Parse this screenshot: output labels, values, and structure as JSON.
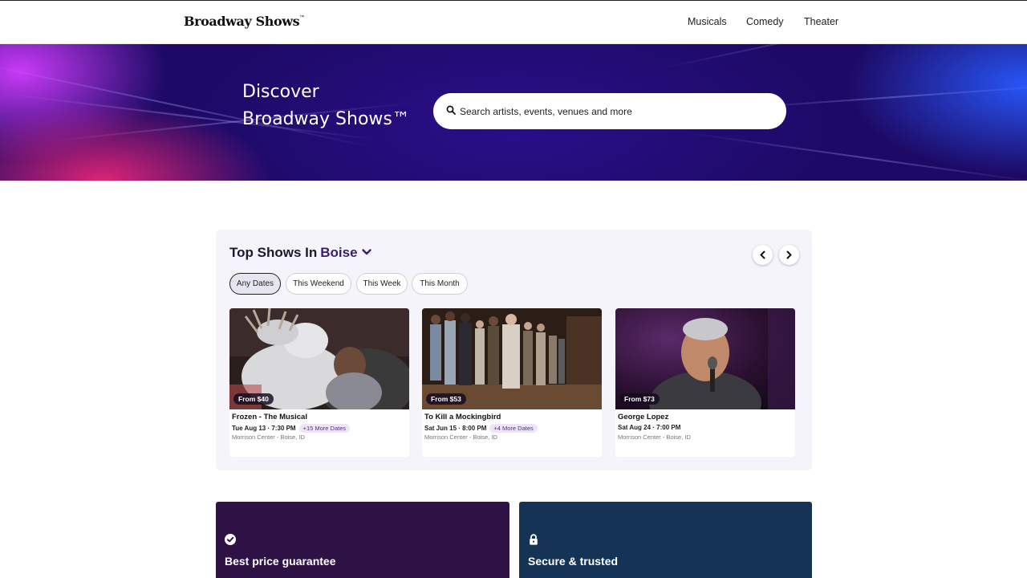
{
  "header": {
    "logo": "Broadway Shows",
    "logo_mark": "™",
    "nav": [
      "Musicals",
      "Comedy",
      "Theater"
    ]
  },
  "hero": {
    "title_line1": "Discover",
    "title_line2": "Broadway Shows™",
    "search": {
      "placeholder": "Search artists, events, venues and more",
      "icon": "search-icon"
    }
  },
  "top_shows": {
    "title": "Top Shows In",
    "city": "Boise",
    "filters": [
      {
        "label": "Any Dates",
        "active": true
      },
      {
        "label": "This Weekend",
        "active": false
      },
      {
        "label": "This Week",
        "active": false
      },
      {
        "label": "This Month",
        "active": false
      }
    ],
    "cards": [
      {
        "price": "From $40",
        "name": "Frozen - The Musical",
        "date": "Tue Aug 13 · 7:30 PM",
        "more_dates": "+15 More Dates",
        "venue": "Morrison Center",
        "location": "- Boise, ID"
      },
      {
        "price": "From $53",
        "name": "To Kill a Mockingbird",
        "date": "Sat Jun 15 · 8:00 PM",
        "more_dates": "+4 More Dates",
        "venue": "Morrison Center",
        "location": "- Boise, ID"
      },
      {
        "price": "From $73",
        "name": "George Lopez",
        "date": "Sat Aug 24 · 7:00 PM",
        "more_dates": "",
        "venue": "Morrison Center",
        "location": "- Boise, ID"
      }
    ]
  },
  "features": [
    {
      "title": "Best price guarantee",
      "icon": "check-circle-icon",
      "color": "#2f1245"
    },
    {
      "title": "Secure & trusted",
      "icon": "lock-icon",
      "color": "#143355"
    }
  ],
  "colors": {
    "accent": "#3a1e6e",
    "hero_base": "#1d0a66"
  }
}
